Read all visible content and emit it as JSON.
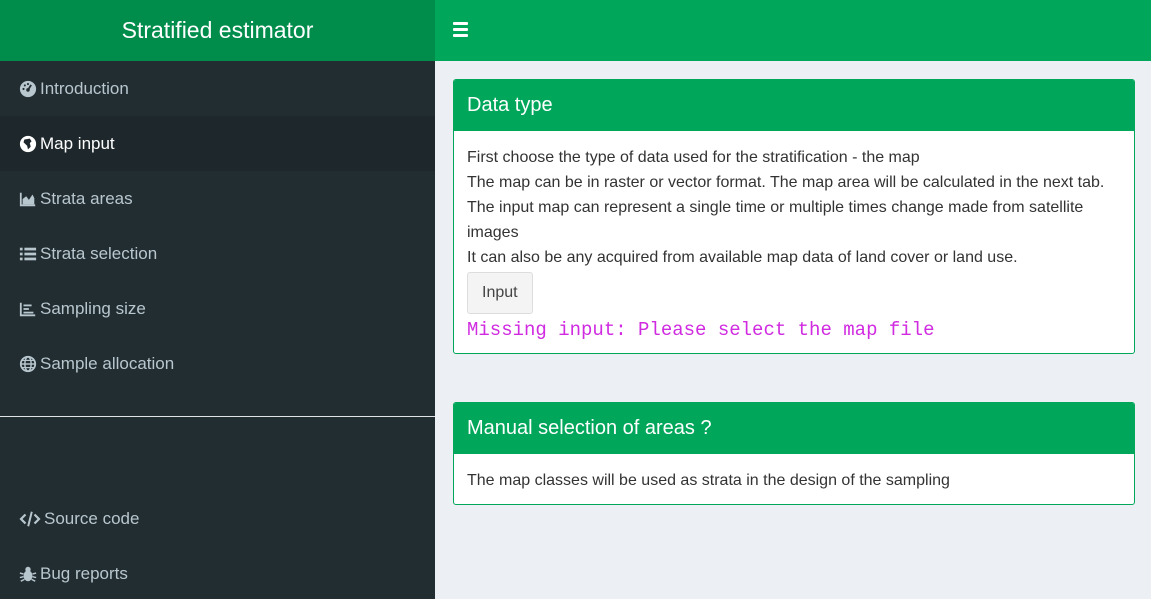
{
  "header": {
    "title": "Stratified estimator"
  },
  "sidebar": {
    "items": [
      {
        "label": "Introduction",
        "icon": "dashboard-icon"
      },
      {
        "label": "Map input",
        "icon": "globe-africa-icon",
        "active": true
      },
      {
        "label": "Strata areas",
        "icon": "area-chart-icon"
      },
      {
        "label": "Strata selection",
        "icon": "list-icon"
      },
      {
        "label": "Sampling size",
        "icon": "bar-chart-icon"
      },
      {
        "label": "Sample allocation",
        "icon": "globe-icon"
      }
    ],
    "footer_items": [
      {
        "label": "Source code",
        "icon": "code-icon"
      },
      {
        "label": "Bug reports",
        "icon": "bug-icon"
      }
    ]
  },
  "main": {
    "data_type": {
      "title": "Data type",
      "lines": [
        "First choose the type of data used for the stratification - the map",
        "The map can be in raster or vector format. The map area will be calculated in the next tab.",
        "The input map can represent a single time or multiple times change made from satellite images",
        "It can also be any acquired from available map data of land cover or land use."
      ],
      "button_label": "Input",
      "error_text": "Missing input: Please select the map file"
    },
    "manual_selection": {
      "title": "Manual selection of areas ?",
      "text": "The map classes will be used as strata in the design of the sampling"
    }
  },
  "colors": {
    "brand_dark": "#008d4c",
    "brand": "#00a65a",
    "sidebar_bg": "#222d32",
    "error": "#d02be0"
  }
}
